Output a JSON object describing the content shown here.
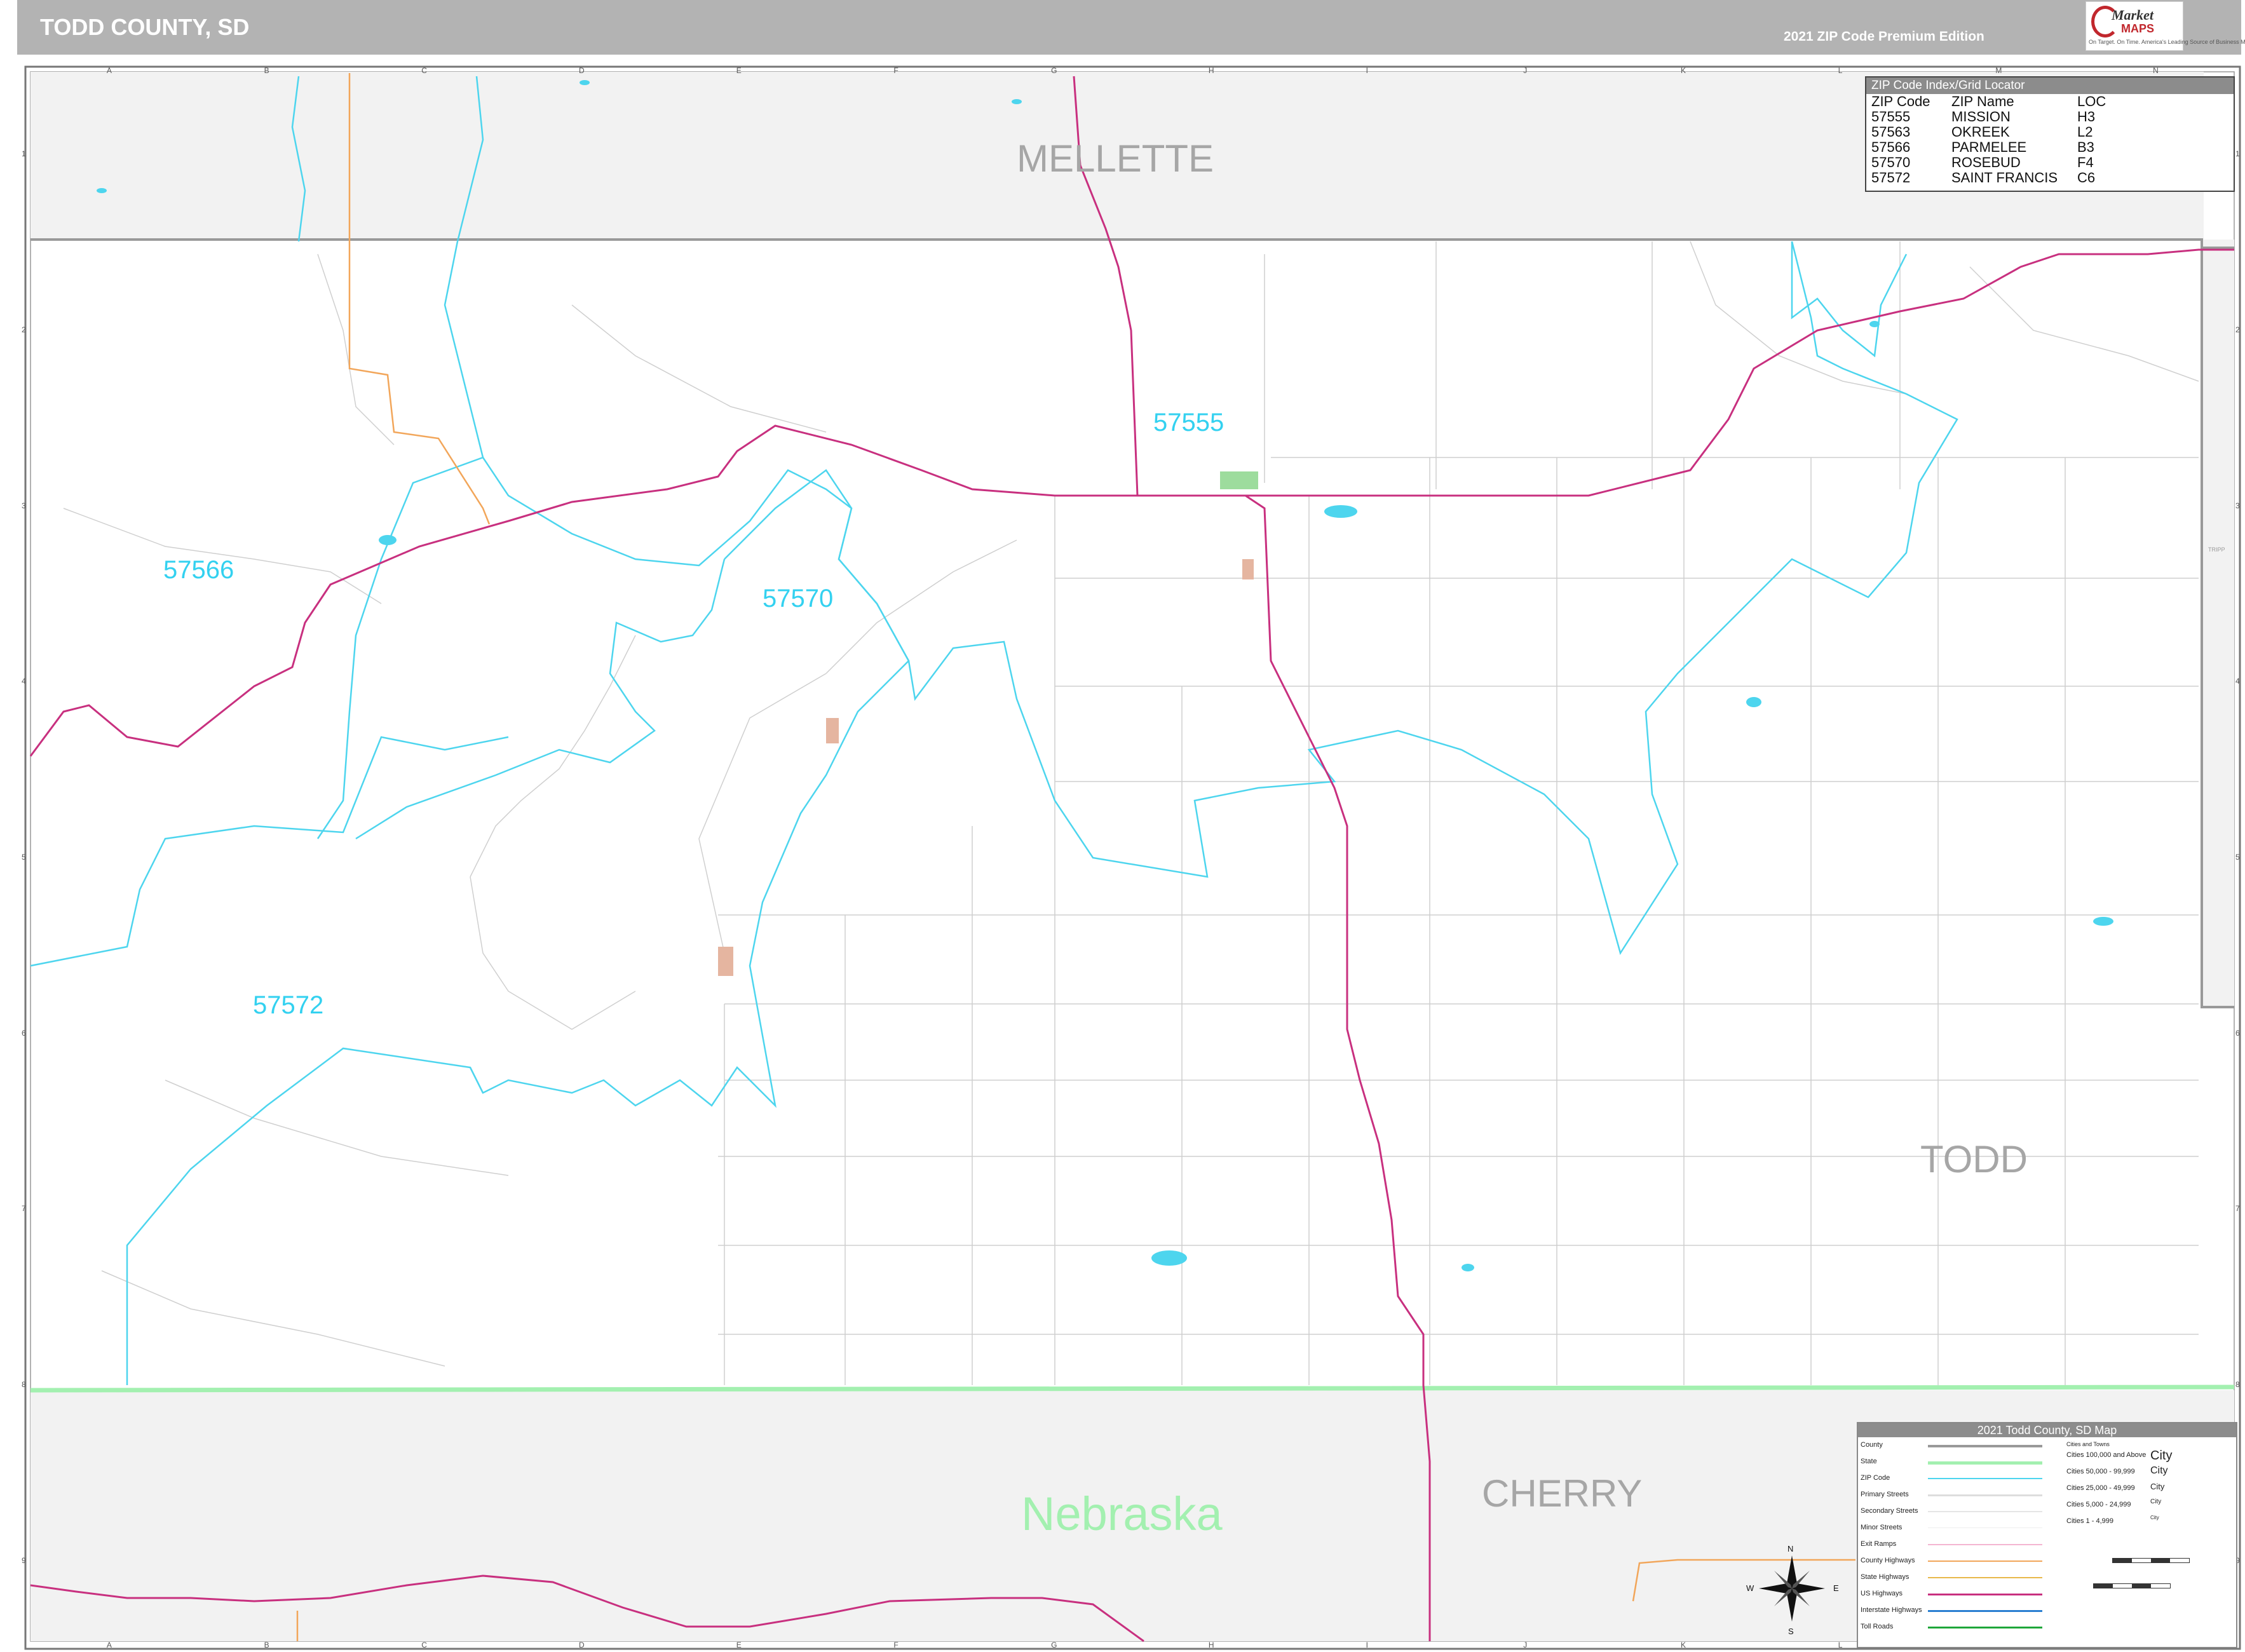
{
  "header": {
    "title": "TODD COUNTY, SD",
    "edition": "2021 ZIP Code Premium Edition",
    "logo_word": "Market",
    "logo_maps": "MAPS",
    "logo_tagline": "On Target. On Time. America's Leading Source of Business Maps"
  },
  "map": {
    "county_labels": [
      "MELLETTE",
      "TODD",
      "CHERRY"
    ],
    "state_label": "Nebraska",
    "side_label": "TRIPP",
    "zip_labels": [
      "57555",
      "57566",
      "57570",
      "57572"
    ],
    "grid_columns": [
      "A",
      "B",
      "C",
      "D",
      "E",
      "F",
      "G",
      "H",
      "I",
      "J",
      "K",
      "L",
      "M",
      "N"
    ],
    "grid_rows": [
      "1",
      "2",
      "3",
      "4",
      "5",
      "6",
      "7",
      "8",
      "9"
    ],
    "colors": {
      "county_boundary": "#999999",
      "state_boundary": "#a3f0b0",
      "zip_boundary": "#4dd5ee",
      "us_highway": "#c8307f",
      "county_highway": "#f2a65a",
      "water": "#4dd5ee"
    }
  },
  "zip_index": {
    "title": "ZIP Code Index/Grid Locator",
    "headers": [
      "ZIP Code",
      "ZIP Name",
      "LOC"
    ],
    "rows": [
      [
        "57555",
        "MISSION",
        "H3"
      ],
      [
        "57563",
        "OKREEK",
        "L2"
      ],
      [
        "57566",
        "PARMELEE",
        "B3"
      ],
      [
        "57570",
        "ROSEBUD",
        "F4"
      ],
      [
        "57572",
        "SAINT FRANCIS",
        "C6"
      ]
    ]
  },
  "legend": {
    "title": "2021 Todd County, SD Map",
    "cities_header": "Cities and Towns",
    "items": [
      "County",
      "State",
      "ZIP Code",
      "Primary Streets",
      "Secondary Streets",
      "Minor Streets",
      "Exit Ramps",
      "County Highways",
      "State Highways",
      "US Highways",
      "Interstate Highways",
      "Toll Roads"
    ],
    "cities": [
      [
        "Cities 100,000 and Above",
        "City"
      ],
      [
        "Cities 50,000 - 99,999",
        "City"
      ],
      [
        "Cities 25,000 - 49,999",
        "City"
      ],
      [
        "Cities 5,000 - 24,999",
        "City"
      ],
      [
        "Cities 1 - 4,999",
        "City"
      ]
    ],
    "compass": [
      "N",
      "E",
      "S",
      "W"
    ]
  }
}
